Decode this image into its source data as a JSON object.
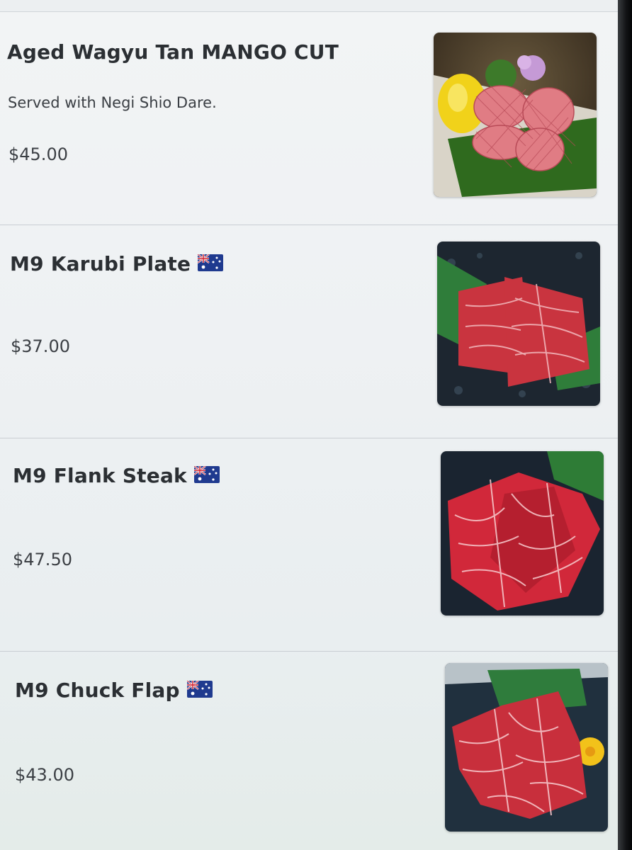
{
  "menu": {
    "items": [
      {
        "name": "Aged Wagyu Tan MANGO CUT",
        "description": "Served with Negi Shio Dare.",
        "price": "$45.00",
        "flag": "",
        "image": "wagyu-tongue-mango-cut-photo"
      },
      {
        "name": "M9 Karubi Plate",
        "description": "",
        "price": "$37.00",
        "flag": "australia-flag-icon",
        "image": "karubi-plate-photo"
      },
      {
        "name": "M9 Flank Steak",
        "description": "",
        "price": "$47.50",
        "flag": "australia-flag-icon",
        "image": "flank-steak-photo"
      },
      {
        "name": "M9 Chuck Flap",
        "description": "",
        "price": "$43.00",
        "flag": "australia-flag-icon",
        "image": "chuck-flap-photo"
      }
    ]
  },
  "colors": {
    "background": "#eef1f3",
    "divider": "#c9ced3",
    "text_primary": "#2b2f33",
    "text_secondary": "#3b3f44"
  }
}
